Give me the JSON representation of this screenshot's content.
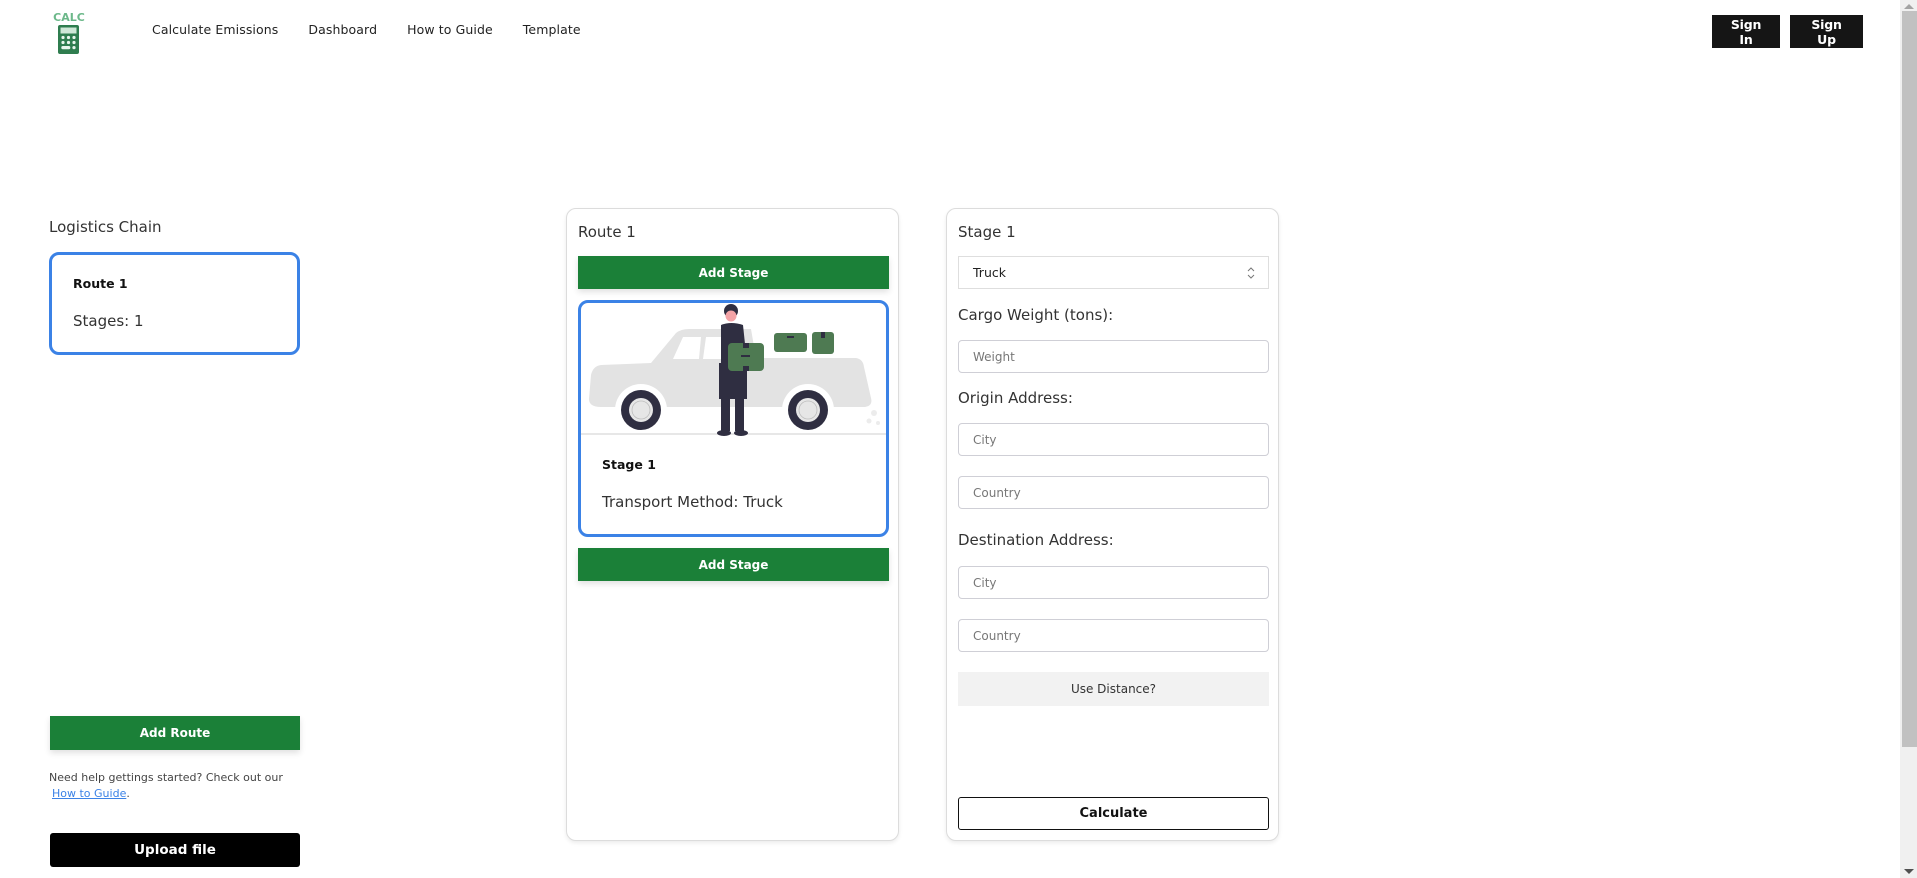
{
  "header": {
    "logo_text": "CALC",
    "nav": [
      {
        "label": "Calculate Emissions"
      },
      {
        "label": "Dashboard"
      },
      {
        "label": "How to Guide"
      },
      {
        "label": "Template"
      }
    ],
    "sign_in": "Sign In",
    "sign_up": "Sign Up"
  },
  "logistics": {
    "title": "Logistics Chain",
    "routes": [
      {
        "title": "Route 1",
        "stages_text": "Stages: 1"
      }
    ],
    "add_route_label": "Add Route",
    "help_text": "Need help gettings started? Check out our",
    "help_link": "How to Guide",
    "help_suffix": ".",
    "upload_label": "Upload file"
  },
  "route_panel": {
    "title": "Route 1",
    "add_stage_label": "Add Stage",
    "stages": [
      {
        "title": "Stage 1",
        "transport_text": "Transport Method: Truck",
        "illustration": "truck-with-person-illustration"
      }
    ]
  },
  "stage_panel": {
    "title": "Stage 1",
    "transport_select": {
      "value": "Truck"
    },
    "cargo_label": "Cargo Weight (tons):",
    "weight_placeholder": "Weight",
    "origin_label": "Origin Address:",
    "destination_label": "Destination Address:",
    "city_placeholder": "City",
    "country_placeholder": "Country",
    "use_distance_label": "Use Distance?",
    "calculate_label": "Calculate"
  },
  "colors": {
    "primary_green": "#1b8038",
    "selection_blue": "#3b82e6",
    "dark_button": "#151515",
    "logo_green": "#5fae7e"
  }
}
